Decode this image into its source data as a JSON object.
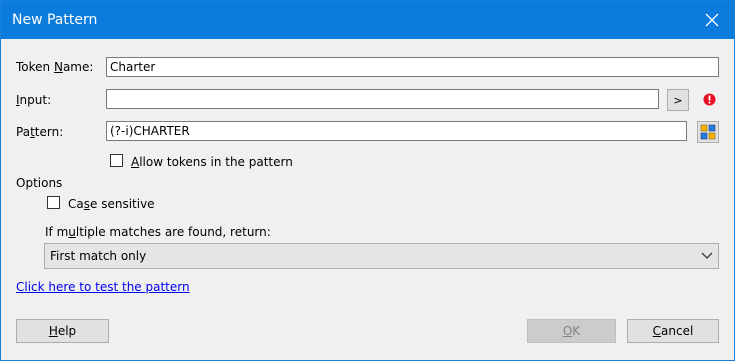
{
  "window": {
    "title": "New Pattern"
  },
  "form": {
    "token_name": {
      "label_pre": "Token ",
      "label_accel": "N",
      "label_post": "ame:",
      "value": "Charter"
    },
    "input": {
      "label_accel": "I",
      "label_post": "nput:",
      "value": "",
      "arrow_label": ">"
    },
    "pattern": {
      "label_pre": "Pa",
      "label_accel": "t",
      "label_post": "tern:",
      "value": "(?-i)CHARTER"
    },
    "allow_tokens": {
      "label_pre": "",
      "label_accel": "A",
      "label_post": "llow tokens in the pattern",
      "checked": false
    }
  },
  "options": {
    "heading": "Options",
    "case_sensitive": {
      "label_pre": "Ca",
      "label_accel": "s",
      "label_post": "e sensitive",
      "checked": false
    },
    "multiple_label": {
      "pre": "If m",
      "accel": "u",
      "post": "ltiple matches are found, return:"
    },
    "multiple_value": "First match only"
  },
  "test_link": "Click here to test the pattern",
  "buttons": {
    "help": {
      "accel": "H",
      "post": "elp"
    },
    "ok": {
      "accel": "O",
      "post": "K"
    },
    "cancel": {
      "accel": "C",
      "post": "ancel"
    }
  },
  "colors": {
    "titlebar": "#0b7bdc",
    "error": "#e81123",
    "link": "#0000ee"
  }
}
